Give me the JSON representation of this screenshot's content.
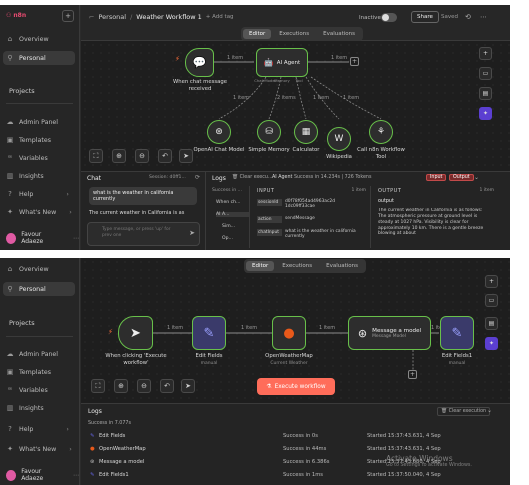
{
  "top": {
    "sidebar": {
      "brand": "n8n",
      "items": [
        {
          "label": "Overview",
          "icon": "home-icon"
        },
        {
          "label": "Personal",
          "icon": "user-icon"
        }
      ],
      "projects_label": "Projects",
      "bottom_items": [
        {
          "label": "Admin Panel",
          "icon": "cloud-icon"
        },
        {
          "label": "Templates",
          "icon": "box-icon"
        },
        {
          "label": "Variables",
          "icon": "variables-icon"
        },
        {
          "label": "Insights",
          "icon": "chart-icon"
        },
        {
          "label": "Help",
          "icon": "help-icon"
        },
        {
          "label": "What's New",
          "icon": "bell-icon"
        }
      ],
      "user": "Favour Adaeze"
    },
    "header": {
      "breadcrumb": "Personal",
      "workflow_name": "Weather Workflow 1",
      "add_tag": "+ Add tag",
      "inactive": "Inactive",
      "share": "Share",
      "saved": "Saved"
    },
    "tabs": [
      "Editor",
      "Executions",
      "Evaluations"
    ],
    "nodes": {
      "trigger": "When chat message received",
      "agent": "AI Agent",
      "agent_sub_left": "Chat Model",
      "agent_sub_mid": "Memory",
      "agent_sub_right": "Tool",
      "model": "OpenAI Chat Model",
      "memory": "Simple Memory",
      "calculator": "Calculator",
      "wikipedia": "Wikipedia",
      "tool": "Call n8n Workflow Tool",
      "edge_items": [
        "1 item",
        "1 item",
        "1 item",
        "2 items",
        "1 item",
        "1 item"
      ]
    },
    "chat": {
      "title": "Chat",
      "session": "Session: d0ff1...",
      "user_msg": "what is the weather in california currently",
      "bot_msg": "The current weather in California is as",
      "placeholder": "Type message, or press 'up' for prev one"
    },
    "logs": {
      "title": "Logs",
      "clear": "Clear execu...",
      "status": "Success in 14.234s",
      "tokens": "726 Tokens",
      "tree": [
        "Success in ...",
        "When ch...",
        "AI A...",
        "Sim...",
        "Op..."
      ],
      "input_label": "INPUT",
      "input_items": "1 item",
      "input_rows": [
        {
          "key": "sessionId",
          "value": "d0f78f054ad4963ac2d 1dc09ff33cae"
        },
        {
          "key": "action",
          "value": "sendMessage"
        },
        {
          "key": "chatInput",
          "value": "what is the weather in california currently"
        }
      ],
      "output_label": "OUTPUT",
      "output_items": "1 item",
      "output_key": "output",
      "output_text": "The current weather in California is as follows: The atmospheric pressure at ground level is steady at 1027 hPa. Visibility is clear for approximately 10 km. There is a gentle breeze blowing at about",
      "btn_input": "Input",
      "btn_output": "Output"
    }
  },
  "bottom": {
    "sidebar": {
      "items": [
        {
          "label": "Overview",
          "icon": "home-icon"
        },
        {
          "label": "Personal",
          "icon": "user-icon"
        }
      ],
      "projects_label": "Projects",
      "bottom_items": [
        {
          "label": "Admin Panel",
          "icon": "cloud-icon"
        },
        {
          "label": "Templates",
          "icon": "box-icon"
        },
        {
          "label": "Variables",
          "icon": "variables-icon"
        },
        {
          "label": "Insights",
          "icon": "chart-icon"
        },
        {
          "label": "Help",
          "icon": "help-icon"
        },
        {
          "label": "What's New",
          "icon": "bell-icon"
        }
      ],
      "user": "Favour Adaeze"
    },
    "tabs": [
      "Editor",
      "Executions",
      "Evaluations"
    ],
    "nodes": [
      {
        "label": "When clicking 'Execute workflow'",
        "sub": ""
      },
      {
        "label": "Edit Fields",
        "sub": "manual"
      },
      {
        "label": "OpenWeatherMap",
        "sub": "Current Weather"
      },
      {
        "label": "Message a model",
        "sub": "Message Model"
      },
      {
        "label": "Edit Fields1",
        "sub": "manual"
      }
    ],
    "edge_items": [
      "1 item",
      "1 item",
      "1 item",
      "1 item"
    ],
    "execute_button": "Execute workflow",
    "logs": {
      "title": "Logs",
      "clear": "Clear execution",
      "status": "Success in 7.077s",
      "rows": [
        {
          "name": "Edit Fields",
          "result": "Success in 0s",
          "started": "Started 15:37:43.631, 4 Sep",
          "color": "#6a6af0"
        },
        {
          "name": "OpenWeatherMap",
          "result": "Success in 44ms",
          "started": "Started 15:37:43.631, 4 Sep",
          "color": "#e8591a"
        },
        {
          "name": "Message a model",
          "result": "Success in 6.386s",
          "started": "Started 15:37:43.680, 4 Sep",
          "color": "#bbbbbb"
        },
        {
          "name": "Edit Fields1",
          "result": "Success in 1ms",
          "started": "Started 15:37:50.040, 4 Sep",
          "color": "#6a6af0"
        }
      ]
    },
    "watermark_title": "Activate Windows",
    "watermark_sub": "Go to Settings to activate Windows."
  }
}
